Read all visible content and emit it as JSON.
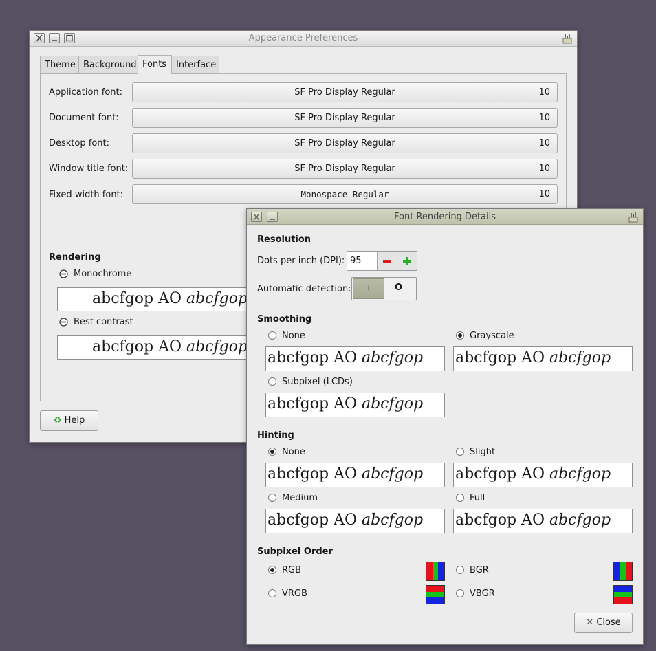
{
  "main_window": {
    "title": "Appearance Preferences",
    "tabs": [
      "Theme",
      "Background",
      "Fonts",
      "Interface"
    ],
    "active_tab": "Fonts",
    "fonts": [
      {
        "label": "Application font:",
        "font": "SF Pro Display Regular",
        "size": "10"
      },
      {
        "label": "Document font:",
        "font": "SF Pro Display Regular",
        "size": "10"
      },
      {
        "label": "Desktop font:",
        "font": "SF Pro Display Regular",
        "size": "10"
      },
      {
        "label": "Window title font:",
        "font": "SF Pro Display Regular",
        "size": "10"
      },
      {
        "label": "Fixed width font:",
        "font": "Monospace Regular",
        "size": "10"
      }
    ],
    "rendering": {
      "heading": "Rendering",
      "options": [
        "Monochrome",
        "Best contrast"
      ],
      "sample_text": "abcfgop AO ",
      "sample_italic": "abcfgop"
    },
    "help_label": "Help"
  },
  "dialog": {
    "title": "Font Rendering Details",
    "resolution": {
      "heading": "Resolution",
      "dpi_label": "Dots per inch (DPI):",
      "dpi_value": "95",
      "auto_label": "Automatic detection:",
      "auto_on_text": "I",
      "auto_off_text": "O"
    },
    "smoothing": {
      "heading": "Smoothing",
      "options": [
        "None",
        "Grayscale",
        "Subpixel (LCDs)"
      ],
      "selected": "Grayscale"
    },
    "hinting": {
      "heading": "Hinting",
      "options": [
        "None",
        "Slight",
        "Medium",
        "Full"
      ],
      "selected": "None"
    },
    "subpixel_order": {
      "heading": "Subpixel Order",
      "options": [
        "RGB",
        "BGR",
        "VRGB",
        "VBGR"
      ],
      "selected": "RGB"
    },
    "sample_text": "abcfgop AO ",
    "sample_italic": "abcfgop",
    "close_label": "Close"
  },
  "colors": {
    "desktop": "#575164",
    "dialog_titlebar": "#c9cdb8",
    "red": "#e8121a",
    "green": "#15c21a",
    "blue": "#1424e0"
  }
}
